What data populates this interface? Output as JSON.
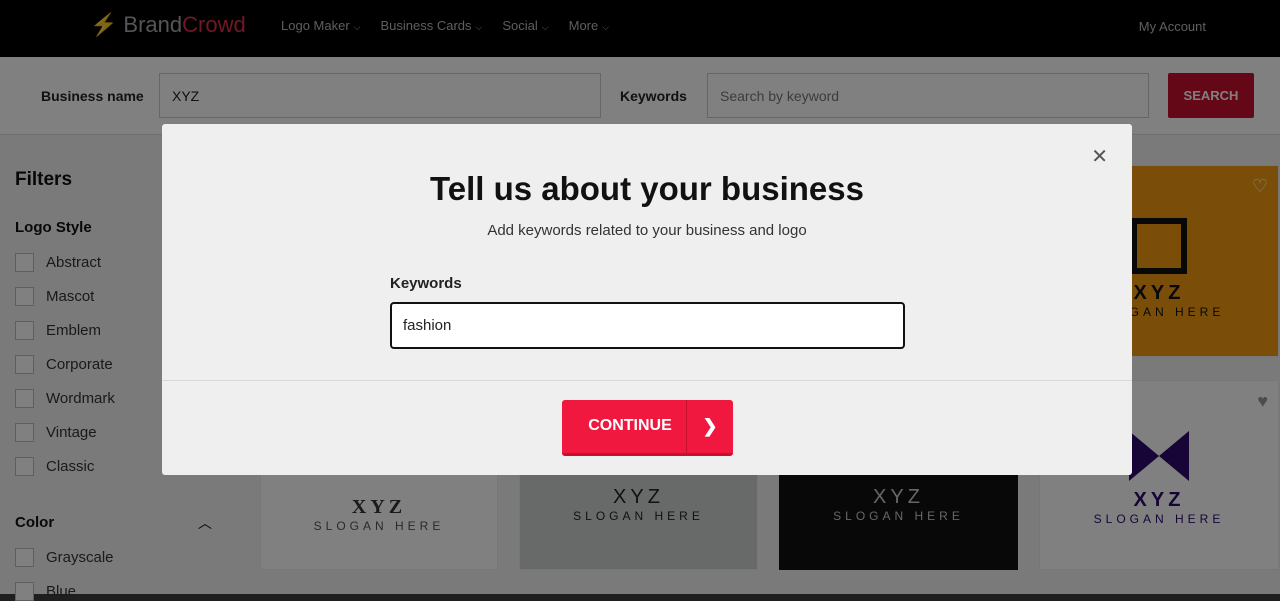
{
  "header": {
    "brand_a": "Brand",
    "brand_b": "Crowd",
    "nav": [
      "Logo Maker",
      "Business Cards",
      "Social",
      "More"
    ],
    "account": "My Account"
  },
  "search": {
    "business_label": "Business name",
    "business_value": "XYZ",
    "keywords_label": "Keywords",
    "keywords_placeholder": "Search by keyword",
    "button": "SEARCH"
  },
  "sidebar": {
    "title": "Filters",
    "logo_style_title": "Logo Style",
    "logo_styles": [
      "Abstract",
      "Mascot",
      "Emblem",
      "Corporate",
      "Wordmark",
      "Vintage",
      "Classic"
    ],
    "color_title": "Color",
    "colors": [
      "Grayscale",
      "Blue"
    ]
  },
  "cards": [
    {
      "name": "XYZ",
      "slogan": "SLOGAN HERE"
    },
    {
      "name": "XYZ",
      "slogan": "SLOGAN HERE"
    },
    {
      "name": "XYZ",
      "slogan": "SLOGAN HERE"
    },
    {
      "name": "XYZ",
      "slogan": "SLOGAN HERE"
    },
    {
      "name": "XYZ",
      "slogan": "SLOGAN HERE"
    }
  ],
  "modal": {
    "title": "Tell us about your business",
    "subtitle": "Add keywords related to your business and logo",
    "keywords_label": "Keywords",
    "keywords_value": "fashion",
    "continue": "CONTINUE"
  },
  "colors": {
    "brand_red": "#f0183f",
    "header_bg": "#000000"
  }
}
